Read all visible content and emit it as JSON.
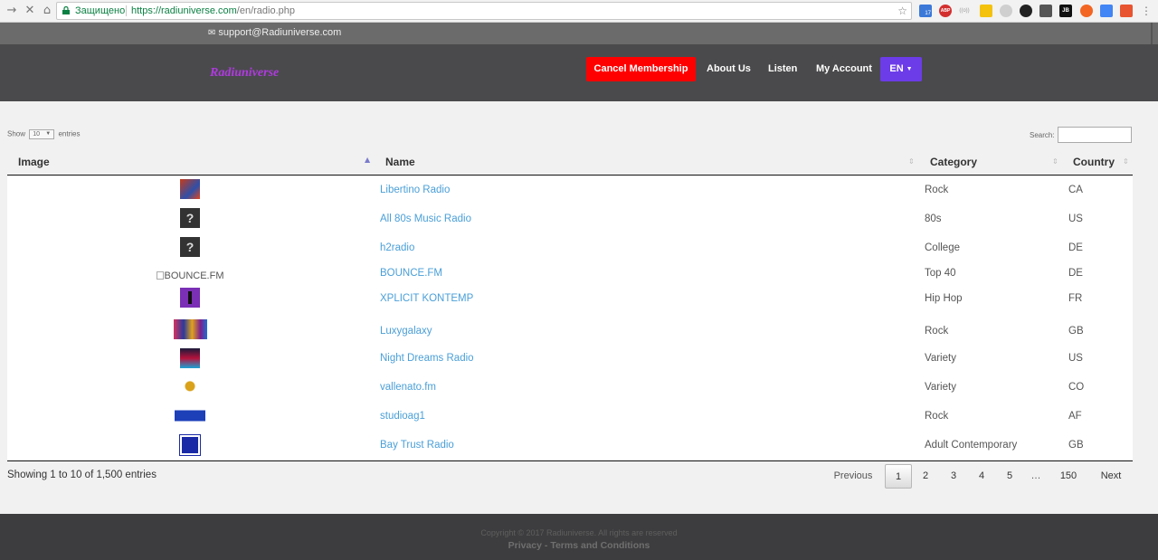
{
  "browser": {
    "secure_label": "Защищено",
    "url_host": "https://radiuniverse.com",
    "url_path": "/en/radio.php",
    "ext_badge": "17",
    "ext_abp": "ABP",
    "ext_rss": "((o))",
    "ext_jb": "JB"
  },
  "topstrip": {
    "email": "support@Radiuniverse.com"
  },
  "header": {
    "logo": "Radiuniverse",
    "cancel_label": "Cancel Membership",
    "about_label": "About Us",
    "listen_label": "Listen",
    "account_label": "My Account",
    "lang_label": "EN"
  },
  "controls": {
    "show_prefix": "Show",
    "show_value": "10",
    "show_suffix": "entries",
    "search_label": "Search:"
  },
  "table": {
    "columns": [
      "Image",
      "Name",
      "Category",
      "Country"
    ],
    "rows": [
      {
        "name": "Libertino Radio",
        "category": "Rock",
        "country": "CA"
      },
      {
        "name": "All 80s Music Radio",
        "category": "80s",
        "country": "US"
      },
      {
        "name": "h2radio",
        "category": "College",
        "country": "DE"
      },
      {
        "name": "BOUNCE.FM",
        "category": "Top 40",
        "country": "DE",
        "img_alt": "BOUNCE.FM"
      },
      {
        "name": "XPLICIT KONTEMP",
        "category": "Hip Hop",
        "country": "FR"
      },
      {
        "name": "Luxygalaxy",
        "category": "Rock",
        "country": "GB"
      },
      {
        "name": "Night Dreams Radio",
        "category": "Variety",
        "country": "US"
      },
      {
        "name": "vallenato.fm",
        "category": "Variety",
        "country": "CO"
      },
      {
        "name": "studioag1",
        "category": "Rock",
        "country": "AF"
      },
      {
        "name": "Bay Trust Radio",
        "category": "Adult Contemporary",
        "country": "GB"
      }
    ]
  },
  "pagination": {
    "info": "Showing 1 to 10 of 1,500 entries",
    "previous": "Previous",
    "pages": [
      "1",
      "2",
      "3",
      "4",
      "5",
      "…",
      "150"
    ],
    "next": "Next"
  },
  "footer": {
    "copyright": "Copyright © 2017 Radiuniverse. All rights are reserved",
    "privacy": "Privacy",
    "separator": "-",
    "terms": "Terms and Conditions"
  }
}
